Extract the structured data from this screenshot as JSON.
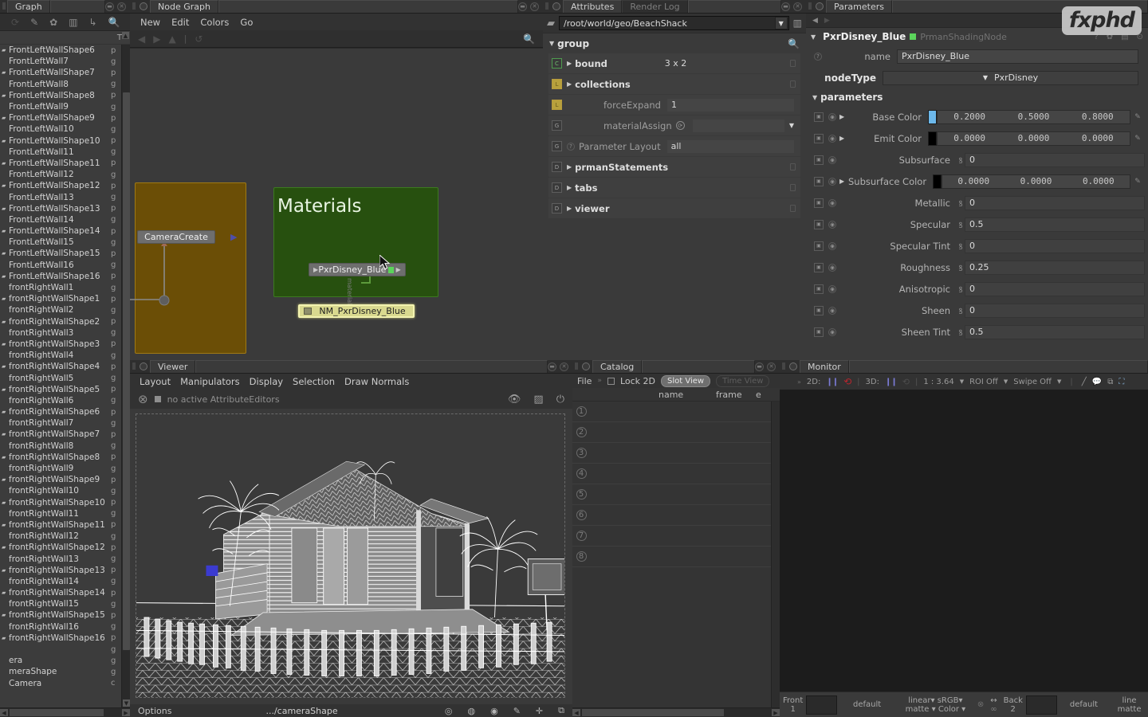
{
  "scenegraph": {
    "tab_label": "Graph",
    "column_header": "T",
    "toolbar_icons": [
      "refresh-icon",
      "pencil-icon",
      "gear-icon",
      "chart-icon",
      "link-icon",
      "search-icon"
    ],
    "items": [
      {
        "name": "FrontLeftWallShape6",
        "type": "p",
        "shape": true
      },
      {
        "name": "FrontLeftWall7",
        "type": "g",
        "shape": false
      },
      {
        "name": "FrontLeftWallShape7",
        "type": "p",
        "shape": true
      },
      {
        "name": "FrontLeftWall8",
        "type": "g",
        "shape": false
      },
      {
        "name": "FrontLeftWallShape8",
        "type": "p",
        "shape": true
      },
      {
        "name": "FrontLeftWall9",
        "type": "g",
        "shape": false
      },
      {
        "name": "FrontLeftWallShape9",
        "type": "p",
        "shape": true
      },
      {
        "name": "FrontLeftWall10",
        "type": "g",
        "shape": false
      },
      {
        "name": "FrontLeftWallShape10",
        "type": "p",
        "shape": true
      },
      {
        "name": "FrontLeftWall11",
        "type": "g",
        "shape": false
      },
      {
        "name": "FrontLeftWallShape11",
        "type": "p",
        "shape": true
      },
      {
        "name": "FrontLeftWall12",
        "type": "g",
        "shape": false
      },
      {
        "name": "FrontLeftWallShape12",
        "type": "p",
        "shape": true
      },
      {
        "name": "FrontLeftWall13",
        "type": "g",
        "shape": false
      },
      {
        "name": "FrontLeftWallShape13",
        "type": "p",
        "shape": true
      },
      {
        "name": "FrontLeftWall14",
        "type": "g",
        "shape": false
      },
      {
        "name": "FrontLeftWallShape14",
        "type": "p",
        "shape": true
      },
      {
        "name": "FrontLeftWall15",
        "type": "g",
        "shape": false
      },
      {
        "name": "FrontLeftWallShape15",
        "type": "p",
        "shape": true
      },
      {
        "name": "FrontLeftWall16",
        "type": "g",
        "shape": false
      },
      {
        "name": "FrontLeftWallShape16",
        "type": "p",
        "shape": true
      },
      {
        "name": "frontRightWall1",
        "type": "g",
        "shape": false
      },
      {
        "name": "frontRightWallShape1",
        "type": "p",
        "shape": true
      },
      {
        "name": "frontRightWall2",
        "type": "g",
        "shape": false
      },
      {
        "name": "frontRightWallShape2",
        "type": "p",
        "shape": true
      },
      {
        "name": "frontRightWall3",
        "type": "g",
        "shape": false
      },
      {
        "name": "frontRightWallShape3",
        "type": "p",
        "shape": true
      },
      {
        "name": "frontRightWall4",
        "type": "g",
        "shape": false
      },
      {
        "name": "frontRightWallShape4",
        "type": "p",
        "shape": true
      },
      {
        "name": "frontRightWall5",
        "type": "g",
        "shape": false
      },
      {
        "name": "frontRightWallShape5",
        "type": "p",
        "shape": true
      },
      {
        "name": "frontRightWall6",
        "type": "g",
        "shape": false
      },
      {
        "name": "frontRightWallShape6",
        "type": "p",
        "shape": true
      },
      {
        "name": "frontRightWall7",
        "type": "g",
        "shape": false
      },
      {
        "name": "frontRightWallShape7",
        "type": "p",
        "shape": true
      },
      {
        "name": "frontRightWall8",
        "type": "g",
        "shape": false
      },
      {
        "name": "frontRightWallShape8",
        "type": "p",
        "shape": true
      },
      {
        "name": "frontRightWall9",
        "type": "g",
        "shape": false
      },
      {
        "name": "frontRightWallShape9",
        "type": "p",
        "shape": true
      },
      {
        "name": "frontRightWall10",
        "type": "g",
        "shape": false
      },
      {
        "name": "frontRightWallShape10",
        "type": "p",
        "shape": true
      },
      {
        "name": "frontRightWall11",
        "type": "g",
        "shape": false
      },
      {
        "name": "frontRightWallShape11",
        "type": "p",
        "shape": true
      },
      {
        "name": "frontRightWall12",
        "type": "g",
        "shape": false
      },
      {
        "name": "frontRightWallShape12",
        "type": "p",
        "shape": true
      },
      {
        "name": "frontRightWall13",
        "type": "g",
        "shape": false
      },
      {
        "name": "frontRightWallShape13",
        "type": "p",
        "shape": true
      },
      {
        "name": "frontRightWall14",
        "type": "g",
        "shape": false
      },
      {
        "name": "frontRightWallShape14",
        "type": "p",
        "shape": true
      },
      {
        "name": "frontRightWall15",
        "type": "g",
        "shape": false
      },
      {
        "name": "frontRightWallShape15",
        "type": "p",
        "shape": true
      },
      {
        "name": "frontRightWall16",
        "type": "g",
        "shape": false
      },
      {
        "name": "frontRightWallShape16",
        "type": "p",
        "shape": true
      },
      {
        "name": "",
        "type": "g",
        "shape": false
      },
      {
        "name": "era",
        "type": "g",
        "shape": false
      },
      {
        "name": "meraShape",
        "type": "g",
        "shape": false
      },
      {
        "name": "Camera",
        "type": "c",
        "shape": false
      }
    ]
  },
  "nodegraph": {
    "tab_label": "Node Graph",
    "menus": [
      "New",
      "Edit",
      "Colors",
      "Go"
    ],
    "groups": [
      {
        "label": "",
        "color": "#7a5a08",
        "fill": "#6d4f06"
      },
      {
        "label": "Materials",
        "color": "#3f7a22",
        "fill": "#274d13"
      }
    ],
    "nodes": [
      {
        "label": "CameraCreate",
        "selected": false
      },
      {
        "label": "PxrDisney_Blue",
        "selected": false,
        "chip": "#5bd45b"
      },
      {
        "label": "NM_PxrDisney_Blue",
        "selected": true
      }
    ],
    "connection_label": "material"
  },
  "attributes": {
    "tab_label": "Attributes",
    "tab_inactive_label": "Render Log",
    "path": "/root/world/geo/BeachShack",
    "group_label": "group",
    "rows": [
      {
        "label": "bound",
        "value": "3 x 2",
        "expandable": true,
        "icon": "C",
        "icon_color": "green",
        "locked": true
      },
      {
        "label": "collections",
        "value": "",
        "expandable": true,
        "icon": "L",
        "icon_color": "yellow",
        "locked": true
      },
      {
        "label": "forceExpand",
        "value": "1",
        "expandable": false,
        "icon": "L",
        "icon_color": "yellow",
        "locked": false
      },
      {
        "label": "materialAssign",
        "value": "",
        "expandable": false,
        "icon": "G",
        "icon_color": "grey",
        "locked": false,
        "dropdown": true
      },
      {
        "label": "Parameter Layout",
        "value": "all",
        "expandable": false,
        "icon": "G",
        "icon_color": "grey",
        "locked": false,
        "help": true
      },
      {
        "label": "prmanStatements",
        "value": "",
        "expandable": true,
        "icon": "D",
        "icon_color": "grey",
        "locked": true
      },
      {
        "label": "tabs",
        "value": "",
        "expandable": true,
        "icon": "D",
        "icon_color": "grey",
        "locked": true
      },
      {
        "label": "viewer",
        "value": "",
        "expandable": true,
        "icon": "D",
        "icon_color": "grey",
        "locked": true
      }
    ]
  },
  "parameters": {
    "tab_label": "Parameters",
    "node_name": "PxrDisney_Blue",
    "node_type_label": "PrmanShadingNode",
    "node_chip_color": "#5bd45b",
    "name_label": "name",
    "name_value": "PxrDisney_Blue",
    "nodetype_label": "nodeType",
    "nodetype_value": "PxrDisney",
    "section_label": "parameters",
    "rows": [
      {
        "label": "Base Color",
        "kind": "color",
        "values": [
          "0.2000",
          "0.5000",
          "0.8000"
        ],
        "swatch": "#6cb8ea",
        "expandable": true
      },
      {
        "label": "Emit Color",
        "kind": "color",
        "values": [
          "0.0000",
          "0.0000",
          "0.0000"
        ],
        "swatch": "#000000",
        "expandable": true
      },
      {
        "label": "Subsurface",
        "kind": "number",
        "value": "0",
        "expandable": false
      },
      {
        "label": "Subsurface Color",
        "kind": "color",
        "values": [
          "0.0000",
          "0.0000",
          "0.0000"
        ],
        "swatch": "#000000",
        "expandable": true
      },
      {
        "label": "Metallic",
        "kind": "number",
        "value": "0",
        "expandable": false
      },
      {
        "label": "Specular",
        "kind": "number",
        "value": "0.5",
        "expandable": false
      },
      {
        "label": "Specular Tint",
        "kind": "number",
        "value": "0",
        "expandable": false
      },
      {
        "label": "Roughness",
        "kind": "number",
        "value": "0.25",
        "expandable": false
      },
      {
        "label": "Anisotropic",
        "kind": "number",
        "value": "0",
        "expandable": false
      },
      {
        "label": "Sheen",
        "kind": "number",
        "value": "0",
        "expandable": false
      },
      {
        "label": "Sheen Tint",
        "kind": "number",
        "value": "0.5",
        "expandable": false
      }
    ]
  },
  "viewer": {
    "tab_label": "Viewer",
    "menus": [
      "Layout",
      "Manipulators",
      "Display",
      "Selection",
      "Draw Normals"
    ],
    "status": "no active AttributeEditors",
    "bottom_left": "Options",
    "bottom_center": ".../cameraShape"
  },
  "catalog": {
    "tab_label": "Catalog",
    "file_menu": "File",
    "lock_label": "Lock 2D",
    "slot_view_label": "Slot View",
    "time_view_label": "Time View",
    "columns": [
      "name",
      "frame",
      "e"
    ],
    "slots": [
      "1",
      "2",
      "3",
      "4",
      "5",
      "6",
      "7",
      "8"
    ]
  },
  "monitor": {
    "tab_label": "Monitor",
    "toolbar": {
      "label_2d": "2D:",
      "label_3d": "3D:",
      "zoom": "1 : 3.64",
      "roi": "ROI Off",
      "swipe": "Swipe Off"
    },
    "bottom": {
      "front_label": "Front",
      "front_index": "1",
      "front_default": "default",
      "front_colorspace": "linear",
      "front_display": "sRGB",
      "front_matte": "matte",
      "front_channel": "Color",
      "back_label": "Back",
      "back_index": "2",
      "back_default": "default",
      "back_colorspace": "line",
      "back_matte": "matte"
    }
  },
  "watermark": {
    "text": "fxphd"
  }
}
